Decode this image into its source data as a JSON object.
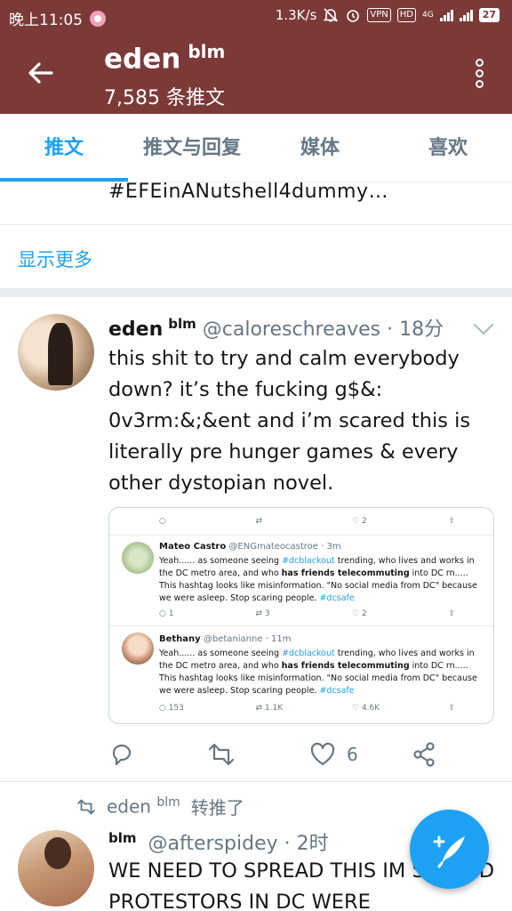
{
  "status_bar": {
    "time": "晚上11:05",
    "speed": "1.3K/s",
    "vpn": "VPN",
    "hd": "HD",
    "net": "4G",
    "battery": "27"
  },
  "header": {
    "name": "eden",
    "name_suffix": "blm",
    "subtitle": "7,585 条推文"
  },
  "tabs": [
    {
      "label": "推文",
      "active": true
    },
    {
      "label": "推文与回复",
      "active": false
    },
    {
      "label": "媒体",
      "active": false
    },
    {
      "label": "喜欢",
      "active": false
    }
  ],
  "previous_tweet": {
    "tail_text": "#EFEinANutshell4dummy…",
    "show_more": "显示更多"
  },
  "tweet1": {
    "name": "eden",
    "name_suffix": "blm",
    "handle": "@caloreschreaves",
    "separator": "·",
    "time": "18分",
    "text": "this shit to try and calm everybody down? it’s the fucking g$&: 0v3rm:&;&ent and i’m scared this is literally pre hunger games & every other dystopian novel.",
    "media": {
      "top_counts": {
        "reply": "",
        "retweet": "",
        "like": "2"
      },
      "reply1": {
        "name": "Mateo Castro",
        "handle": "@ENGmateocastroe",
        "time": "· 3m",
        "text_a": "Yeah...... as someone seeing ",
        "link1": "#dcblackout",
        "text_b": " trending, who lives and works in the DC metro area, and who ",
        "bold": "has friends telecommuting",
        "text_c": " into DC rn..... This hashtag looks like misinformation. \"No social media from DC\" because we were asleep. Stop scaring people. ",
        "link2": "#dcsafe",
        "counts": {
          "reply": "1",
          "retweet": "3",
          "like": "2"
        }
      },
      "reply2": {
        "name": "Bethany",
        "handle": "@betanianne",
        "time": "· 11m",
        "text_a": "Yeah...... as someone seeing ",
        "link1": "#dcblackout",
        "text_b": " trending, who lives and works in the DC metro area, and who ",
        "bold": "has friends telecommuting",
        "text_c": " into DC rn..... This hashtag looks like misinformation. \"No social media from DC\" because we were asleep. Stop scaring people. ",
        "link2": "#dcsafe",
        "counts": {
          "reply": "153",
          "retweet": "1.1K",
          "like": "4.6K"
        }
      }
    },
    "like_count": "6"
  },
  "retweet_note": {
    "name": "eden",
    "name_suffix": "blm",
    "action": "转推了"
  },
  "tweet2": {
    "name_prefix": "blm",
    "handle": "@afterspidey",
    "separator": "·",
    "time": "2时",
    "text": "WE NEED TO SPREAD THIS IM SCARED PROTESTORS IN DC WERE"
  },
  "colors": {
    "header_bg": "#7b3a38",
    "accent": "#1da1f2",
    "muted": "#657786"
  },
  "icons": [
    "back-arrow-icon",
    "more-vertical-icon",
    "chevron-down-icon",
    "reply-icon",
    "retweet-icon",
    "like-icon",
    "share-icon",
    "compose-icon"
  ]
}
